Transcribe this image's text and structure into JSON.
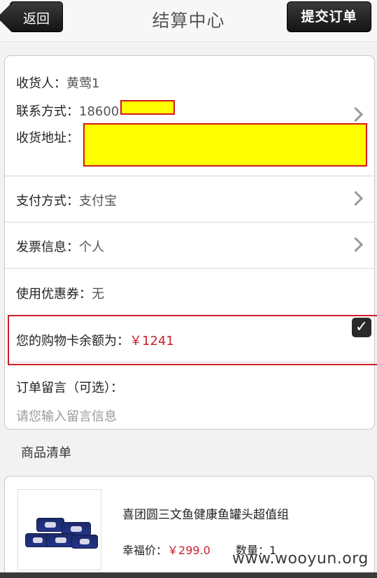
{
  "header": {
    "back_label": "返回",
    "title": "结算中心",
    "submit_label": "提交订单"
  },
  "address": {
    "recipient_label": "收货人：",
    "recipient_value": "黄莺1",
    "phone_label": "联系方式：",
    "phone_value": "18600",
    "address_label": "收货地址："
  },
  "payment": {
    "label": "支付方式：",
    "value": "支付宝"
  },
  "invoice": {
    "label": "发票信息：",
    "value": "个人"
  },
  "coupon": {
    "label": "使用优惠券：",
    "value": "无"
  },
  "gift_card": {
    "label": "您的购物卡余额为：",
    "value": "￥1241",
    "checked": true,
    "check_glyph": "✓"
  },
  "message": {
    "label": "订单留言（可选）：",
    "placeholder": "请您输入留言信息"
  },
  "products": {
    "section_title": "商品清单",
    "items": [
      {
        "name": "喜团圆三文鱼健康鱼罐头超值组",
        "price_label": "幸福价：",
        "price_value": "￥299.0",
        "qty_label": "数量：",
        "qty_value": "1"
      }
    ]
  },
  "watermark": "www.wooyun.org",
  "colors": {
    "price_red": "#cc1f2a",
    "redact_yellow": "#ffff00",
    "button_dark": "#1e1e1e"
  },
  "icons": {
    "chevron": "chevron-right-icon",
    "checkbox": "checkbox-checked-icon"
  }
}
